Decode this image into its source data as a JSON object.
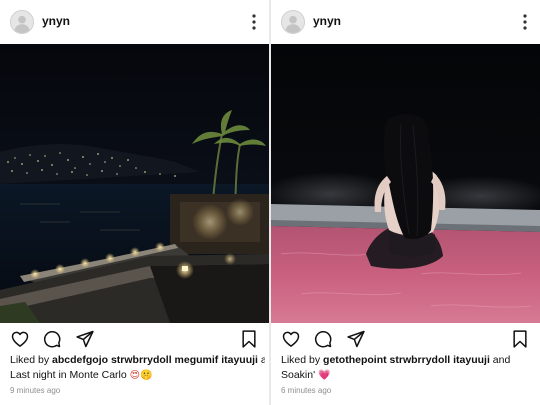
{
  "posts": [
    {
      "username": "ynyn",
      "liked_by_prefix": "Liked by ",
      "liked_by_names": "abcdefgojo strwbrrydoll megumif itayuuji",
      "liked_by_suffix": " and",
      "caption": "Last night in Monte Carlo ",
      "caption_emojis": [
        "😍",
        "🤫"
      ],
      "timestamp": "9 minutes ago"
    },
    {
      "username": "ynyn",
      "liked_by_prefix": "Liked by ",
      "liked_by_names": "getothepoint strwbrrydoll itayuuji",
      "liked_by_suffix": " and",
      "caption": "Soakin' ",
      "caption_emojis": [
        "💗"
      ],
      "timestamp": "6 minutes ago"
    }
  ],
  "icons": {
    "like": "heart-icon",
    "comment": "comment-icon",
    "share": "paper-plane-icon",
    "save": "bookmark-icon",
    "more": "vertical-ellipsis-icon",
    "avatar": "default-avatar-icon"
  },
  "colors": {
    "text": "#111111",
    "timestamp": "#8e8e8e",
    "pool_water": "#c9607f",
    "night_sky": "#07090f"
  }
}
